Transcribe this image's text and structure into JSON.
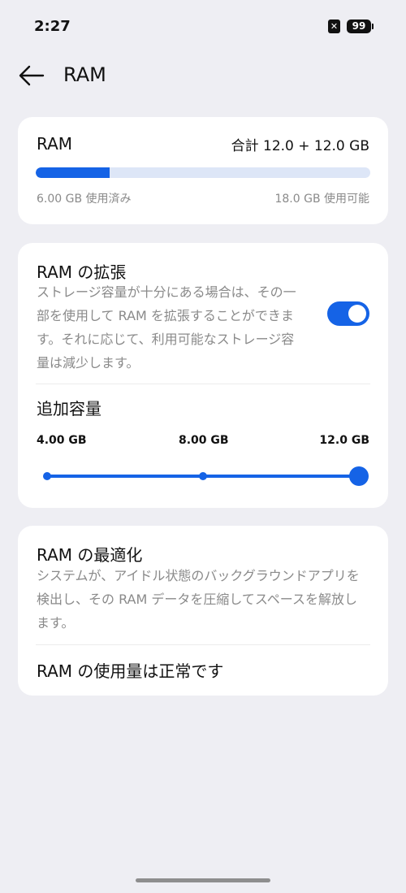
{
  "status_bar": {
    "time": "2:27",
    "notification_icon": "x-icon",
    "battery_level": "99"
  },
  "header": {
    "back_icon": "arrow-left-icon",
    "title": "RAM"
  },
  "ram_usage": {
    "label": "RAM",
    "total": "合計 12.0 + 12.0 GB",
    "used_fraction": 0.222,
    "used_text": "6.00 GB 使用済み",
    "available_text": "18.0 GB 使用可能"
  },
  "ram_expansion": {
    "title": "RAM の拡張",
    "description": "ストレージ容量が十分にある場合は、その一部を使用して RAM を拡張することができます。それに応じて、利用可能なストレージ容量は減少します。",
    "enabled": true,
    "capacity_title": "追加容量",
    "options": [
      "4.00 GB",
      "8.00 GB",
      "12.0 GB"
    ],
    "selected_index": 2
  },
  "ram_optimization": {
    "title": "RAM の最適化",
    "description": "システムが、アイドル状態のバックグラウンドアプリを検出し、その RAM データを圧縮してスペースを解放します。",
    "status": "RAM の使用量は正常です"
  },
  "colors": {
    "accent": "#1563e6",
    "background": "#eeeef3",
    "card": "#ffffff",
    "secondary_text": "#8a8a8a"
  }
}
